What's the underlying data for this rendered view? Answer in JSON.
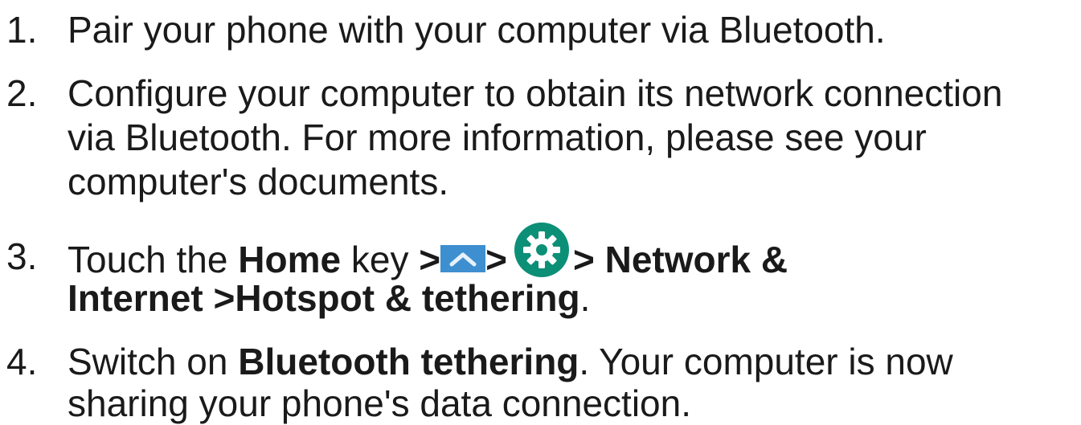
{
  "steps": [
    {
      "number": "1.",
      "lines": [
        "Pair your phone with your computer via Bluetooth."
      ]
    },
    {
      "number": "2.",
      "lines": [
        "Configure your computer to obtain its network connection",
        "via Bluetooth. For more information, please see your",
        "computer's documents."
      ]
    },
    {
      "number": "3.",
      "text_touch": "Touch the ",
      "home": "Home",
      "text_key": " key ",
      "sep1": ">",
      "sep2": ">",
      "path_1": "> Network &",
      "path_2": "Internet >Hotspot & tethering",
      "end": ".",
      "icons": [
        "chevron-up-icon",
        "settings-gear-icon"
      ]
    },
    {
      "number": "4.",
      "text_switch": "Switch on ",
      "bold": "Bluetooth tethering",
      "text_rest": ". Your computer is now",
      "line_2": "sharing your phone's data connection."
    }
  ],
  "colors": {
    "text": "#1a1a1a",
    "up_icon_bg": "#3d8fd0",
    "up_icon_chevron": "#e7f1fa",
    "gear_bg": "#0c8f77",
    "gear_fg": "#ffffff"
  }
}
